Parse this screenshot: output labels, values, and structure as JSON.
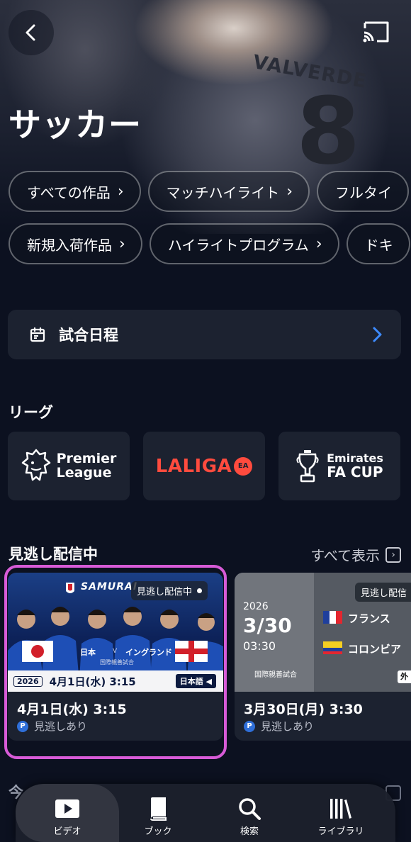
{
  "page": {
    "title": "サッカー"
  },
  "hero": {
    "jersey_name": "VALVERDE",
    "jersey_number": "8"
  },
  "chips_row1": [
    {
      "label": "すべての作品"
    },
    {
      "label": "マッチハイライト"
    },
    {
      "label": "フルタイ"
    }
  ],
  "chips_row2": [
    {
      "label": "新規入荷作品"
    },
    {
      "label": "ハイライトプログラム"
    },
    {
      "label": "ドキ"
    }
  ],
  "schedule": {
    "label": "試合日程",
    "icon": "calendar-icon"
  },
  "leagues": {
    "title": "リーグ",
    "items": [
      {
        "name": "Premier League",
        "line1": "Premier",
        "line2": "League"
      },
      {
        "name": "LALIGA",
        "text": "LALIGA",
        "ea": "EA",
        "color": "#ff4b3e"
      },
      {
        "name": "Emirates FA CUP",
        "line1": "Emirates",
        "line2": "FA CUP"
      }
    ]
  },
  "missed": {
    "title": "見逃し配信中",
    "see_all": "すべて表示",
    "cards": [
      {
        "badge": "見逃し配信中",
        "brand": "SAMURAI",
        "team_left": "日本",
        "vs": "V",
        "team_right": "イングランド",
        "match_type": "国際親善試合",
        "banner_year": "2026",
        "banner_date": "4月1日(水) 3:15",
        "banner_lang": "日本語",
        "date_text": "4月1日(水) 3:15",
        "availability": "見逃しあり"
      },
      {
        "badge": "見逃し配信",
        "year": "2026",
        "date": "3/30",
        "time": "03:30",
        "team_home": "フランス",
        "team_away": "コロンビア",
        "match_type": "国際親善試合",
        "corner_tag": "外",
        "date_text": "3月30日(月) 3:30",
        "availability": "見逃しあり"
      }
    ]
  },
  "next_section_partial": "今",
  "nav": [
    {
      "label": "ビデオ",
      "icon": "play-video-icon",
      "active": true
    },
    {
      "label": "ブック",
      "icon": "book-icon",
      "active": false
    },
    {
      "label": "検索",
      "icon": "search-icon",
      "active": false
    },
    {
      "label": "ライブラリ",
      "icon": "library-icon",
      "active": false
    }
  ],
  "colors": {
    "background": "#0c1120",
    "card": "#1c2230",
    "accent_blue": "#3d8bff",
    "highlight": "#d75bd7"
  }
}
